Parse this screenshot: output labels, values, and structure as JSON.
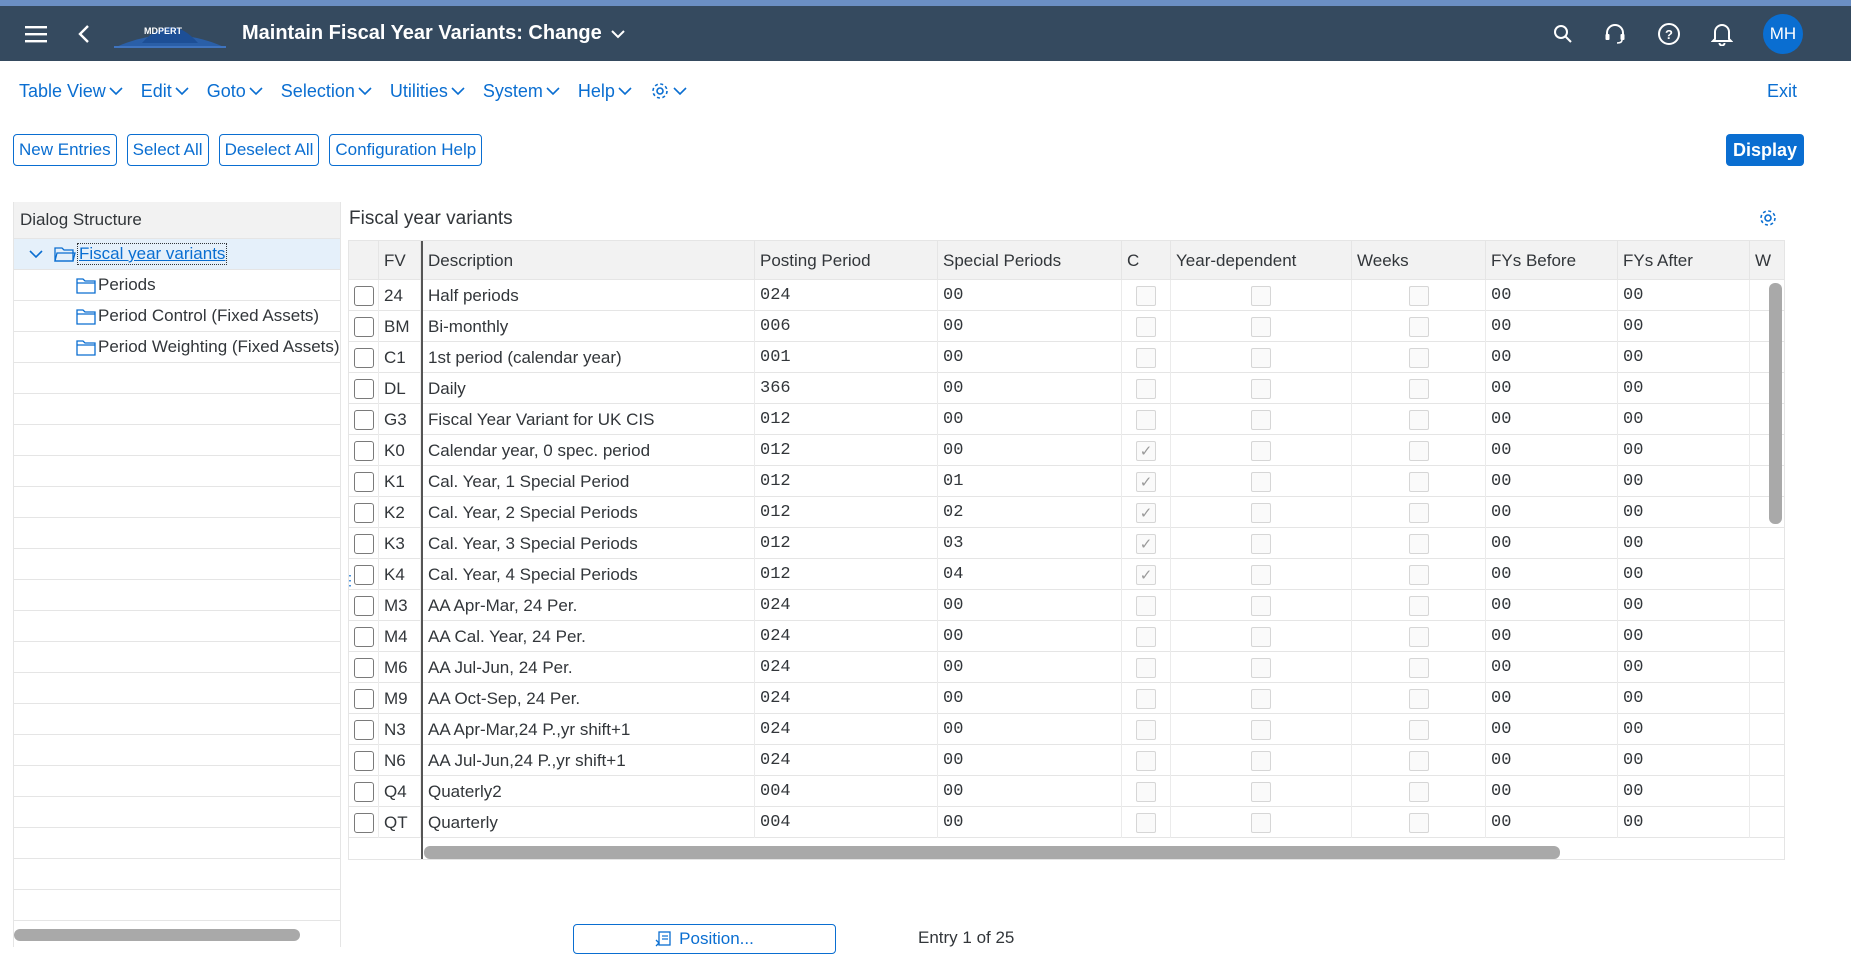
{
  "shell": {
    "title": "Maintain Fiscal Year Variants: Change",
    "logo_text": "MDPERT",
    "avatar": "MH"
  },
  "menu": {
    "items": [
      "Table View",
      "Edit",
      "Goto",
      "Selection",
      "Utilities",
      "System",
      "Help"
    ],
    "exit": "Exit"
  },
  "toolbar": {
    "new_entries": "New Entries",
    "select_all": "Select All",
    "deselect_all": "Deselect All",
    "config_help": "Configuration Help",
    "display": "Display"
  },
  "dialog": {
    "header": "Dialog Structure",
    "items": [
      {
        "label": "Fiscal year variants"
      },
      {
        "label": "Periods"
      },
      {
        "label": "Period Control (Fixed Assets)"
      },
      {
        "label": "Period Weighting (Fixed Assets)"
      }
    ]
  },
  "grid": {
    "title": "Fiscal year variants",
    "columns": [
      "FV",
      "Description",
      "Posting Period",
      "Special Periods",
      "C",
      "Year-dependent",
      "Weeks",
      "FYs Before",
      "FYs After",
      "W"
    ],
    "rows": [
      {
        "fv": "24",
        "desc": "Half periods",
        "post": "024",
        "spec": "00",
        "c": false,
        "before": "00",
        "after": "00"
      },
      {
        "fv": "BM",
        "desc": "Bi-monthly",
        "post": "006",
        "spec": "00",
        "c": false,
        "before": "00",
        "after": "00"
      },
      {
        "fv": "C1",
        "desc": "1st period (calendar year)",
        "post": "001",
        "spec": "00",
        "c": false,
        "before": "00",
        "after": "00"
      },
      {
        "fv": "DL",
        "desc": "Daily",
        "post": "366",
        "spec": "00",
        "c": false,
        "before": "00",
        "after": "00"
      },
      {
        "fv": "G3",
        "desc": "Fiscal Year Variant for UK CIS",
        "post": "012",
        "spec": "00",
        "c": false,
        "before": "00",
        "after": "00"
      },
      {
        "fv": "K0",
        "desc": "Calendar year, 0 spec. period",
        "post": "012",
        "spec": "00",
        "c": true,
        "before": "00",
        "after": "00"
      },
      {
        "fv": "K1",
        "desc": "Cal. Year, 1 Special Period",
        "post": "012",
        "spec": "01",
        "c": true,
        "before": "00",
        "after": "00"
      },
      {
        "fv": "K2",
        "desc": "Cal. Year, 2 Special Periods",
        "post": "012",
        "spec": "02",
        "c": true,
        "before": "00",
        "after": "00"
      },
      {
        "fv": "K3",
        "desc": "Cal. Year, 3 Special Periods",
        "post": "012",
        "spec": "03",
        "c": true,
        "before": "00",
        "after": "00"
      },
      {
        "fv": "K4",
        "desc": "Cal. Year, 4 Special Periods",
        "post": "012",
        "spec": "04",
        "c": true,
        "before": "00",
        "after": "00"
      },
      {
        "fv": "M3",
        "desc": "AA Apr-Mar, 24 Per.",
        "post": "024",
        "spec": "00",
        "c": false,
        "before": "00",
        "after": "00"
      },
      {
        "fv": "M4",
        "desc": "AA Cal. Year, 24 Per.",
        "post": "024",
        "spec": "00",
        "c": false,
        "before": "00",
        "after": "00"
      },
      {
        "fv": "M6",
        "desc": "AA Jul-Jun, 24 Per.",
        "post": "024",
        "spec": "00",
        "c": false,
        "before": "00",
        "after": "00"
      },
      {
        "fv": "M9",
        "desc": "AA Oct-Sep, 24 Per.",
        "post": "024",
        "spec": "00",
        "c": false,
        "before": "00",
        "after": "00"
      },
      {
        "fv": "N3",
        "desc": "AA Apr-Mar,24 P.,yr shift+1",
        "post": "024",
        "spec": "00",
        "c": false,
        "before": "00",
        "after": "00"
      },
      {
        "fv": "N6",
        "desc": "AA Jul-Jun,24 P.,yr shift+1",
        "post": "024",
        "spec": "00",
        "c": false,
        "before": "00",
        "after": "00"
      },
      {
        "fv": "Q4",
        "desc": "Quaterly2",
        "post": "004",
        "spec": "00",
        "c": false,
        "before": "00",
        "after": "00"
      },
      {
        "fv": "QT",
        "desc": "Quarterly",
        "post": "004",
        "spec": "00",
        "c": false,
        "before": "00",
        "after": "00"
      }
    ]
  },
  "footer": {
    "position": "Position...",
    "entry": "Entry 1 of 25"
  }
}
